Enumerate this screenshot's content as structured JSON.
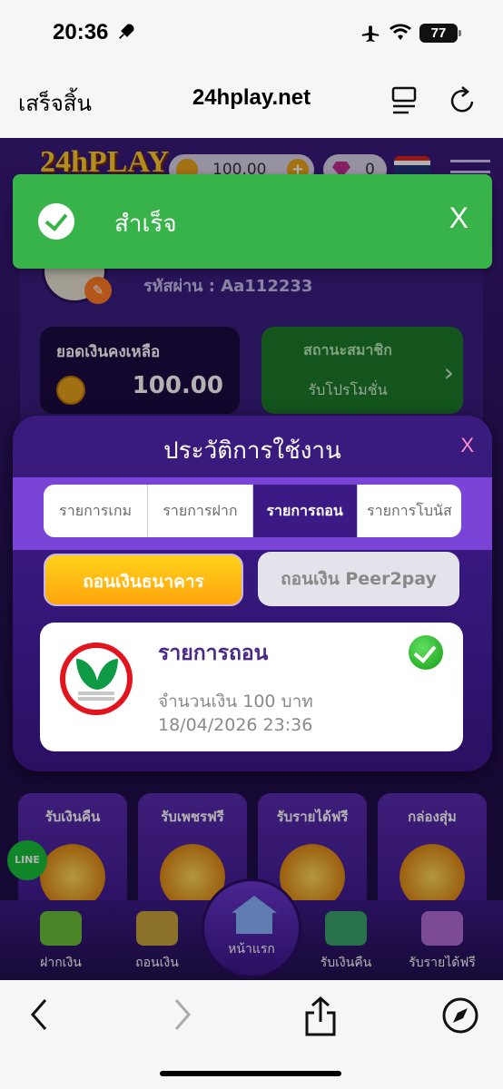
{
  "status_bar": {
    "time": "20:36",
    "battery": "77"
  },
  "browser": {
    "done_label": "เสร็จสิ้น",
    "url": "24hplay.net"
  },
  "site": {
    "logo": "24hPLAY",
    "coin_balance": "100.00",
    "gem_balance": "0",
    "password_line": "รหัสผ่าน : Aa112233",
    "balance_label": "ยอดเงินคงเหลือ",
    "balance_amount": "100.00",
    "member_status_label": "สถานะสมาชิก",
    "member_promo_label": "รับโปรโมชั่น",
    "promo_tiles": [
      {
        "label": "รับเงินคืน"
      },
      {
        "label": "รับเพชรฟรี"
      },
      {
        "label": "รับรายได้ฟรี"
      },
      {
        "label": "กล่องสุ่ม"
      }
    ],
    "line_badge": "LINE",
    "nav": {
      "deposit": "ฝากเงิน",
      "withdraw": "ถอนเงิน",
      "home": "หน้าแรก",
      "cashback": "รับเงินคืน",
      "income": "รับรายได้ฟรี"
    }
  },
  "toast": {
    "message": "สำเร็จ",
    "close": "X"
  },
  "modal": {
    "title": "ประวัติการใช้งาน",
    "close": "X",
    "tabs": [
      "รายการเกม",
      "รายการฝาก",
      "รายการถอน",
      "รายการโบนัส"
    ],
    "active_tab": "รายการถอน",
    "bank_button": "ถอนเงินธนาคาร",
    "p2p_button": "ถอนเงิน Peer2pay",
    "record": {
      "title": "รายการถอน",
      "amount_text": "จำนวนเงิน 100 บาท",
      "datetime": "18/04/2026 23:36"
    }
  },
  "colors": {
    "toast_green": "#37b34a",
    "modal_purple": "#3b1a86",
    "bank_button_yellow": "#ffd21a",
    "kbank_red": "#e2141e",
    "kbank_green": "#0f9a46"
  }
}
